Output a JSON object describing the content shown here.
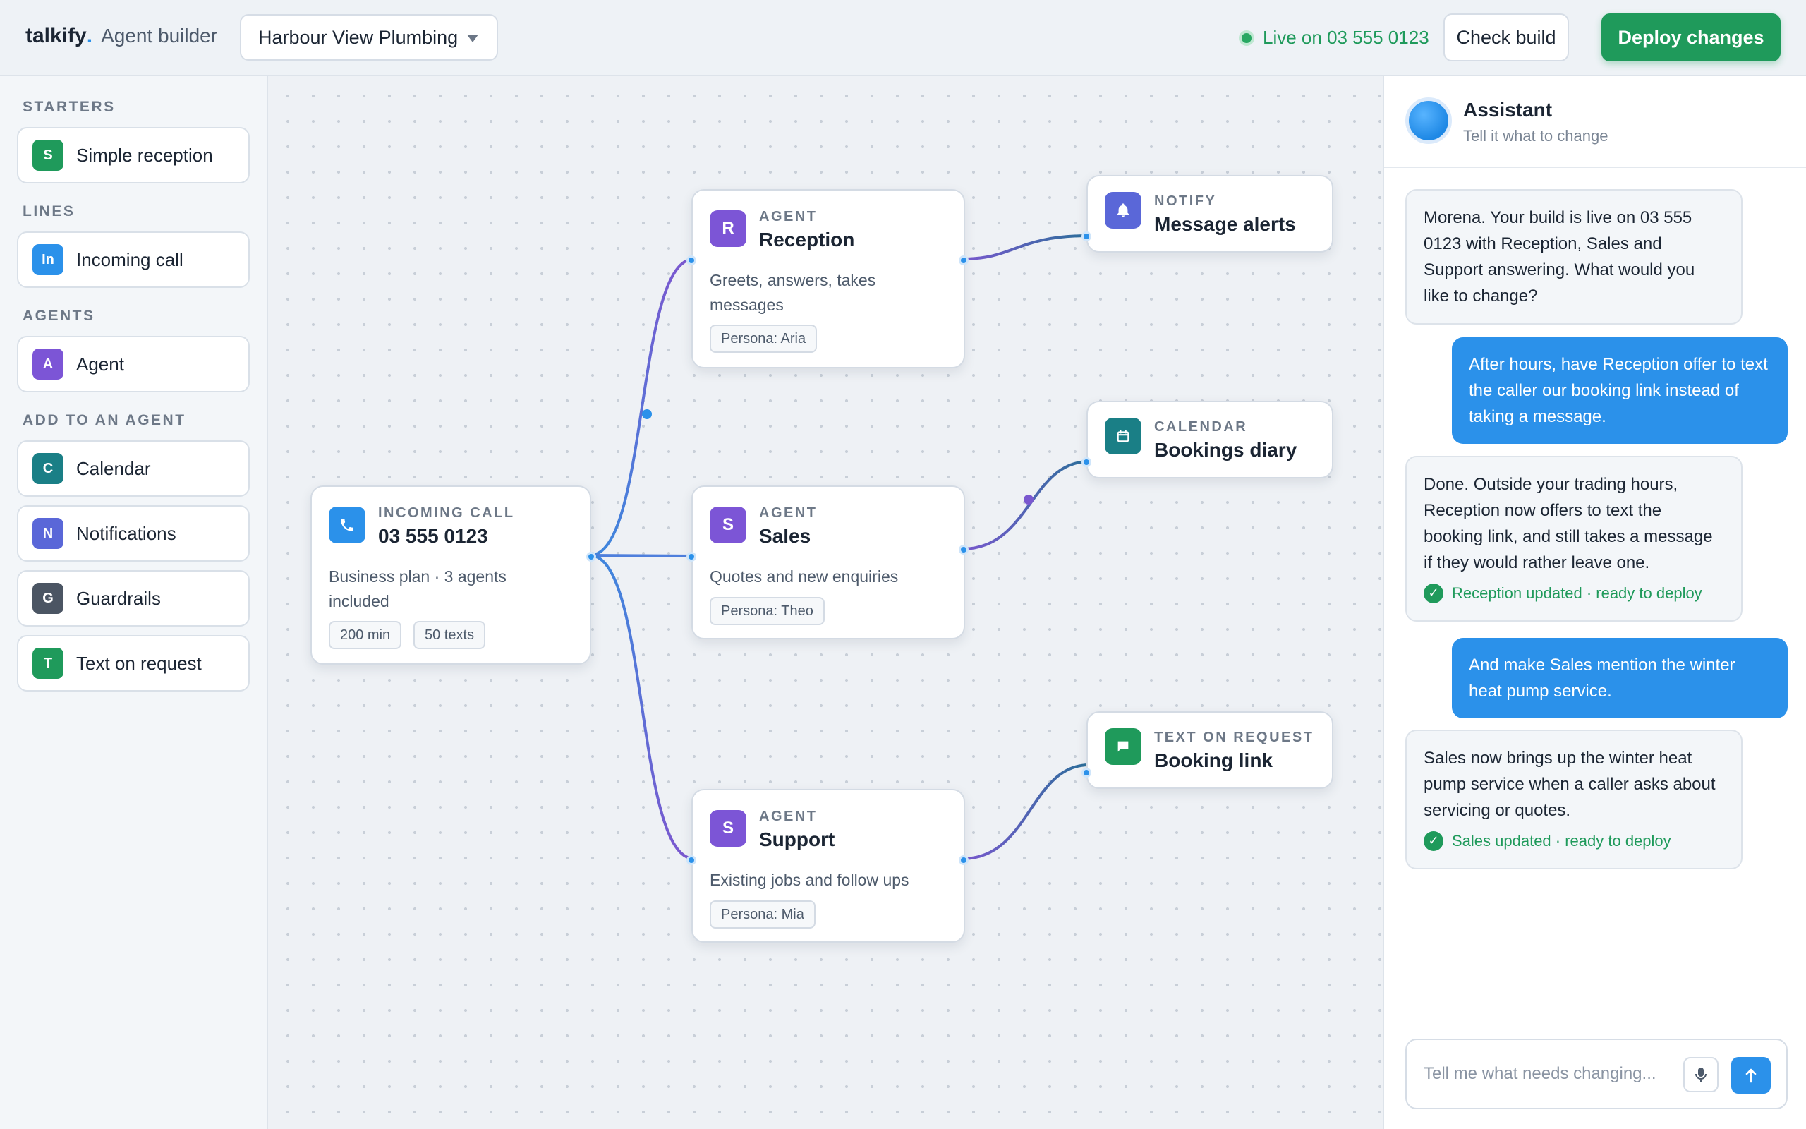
{
  "app": {
    "brand": "talkify",
    "brand_dot": ".",
    "subtitle": "Agent builder"
  },
  "workspace": {
    "name": "Harbour View Plumbing"
  },
  "header": {
    "live_status": "Live on 03 555 0123",
    "check_label": "Check build",
    "deploy_label": "Deploy changes"
  },
  "palette": {
    "starters": {
      "heading": "STARTERS",
      "items": [
        {
          "badge": "S",
          "label": "Simple reception",
          "color": "#1f9a5b"
        }
      ]
    },
    "lines": {
      "heading": "LINES",
      "items": [
        {
          "badge": "In",
          "label": "Incoming call",
          "color": "#2b91ea"
        }
      ]
    },
    "agents": {
      "heading": "AGENTS",
      "items": [
        {
          "badge": "A",
          "label": "Agent",
          "color": "#7c55d6"
        }
      ]
    },
    "add": {
      "heading": "ADD TO AN AGENT",
      "items": [
        {
          "badge": "C",
          "label": "Calendar",
          "color": "#1a7f86"
        },
        {
          "badge": "N",
          "label": "Notifications",
          "color": "#5a67d8"
        },
        {
          "badge": "G",
          "label": "Guardrails",
          "color": "#4b5563"
        },
        {
          "badge": "T",
          "label": "Text on request",
          "color": "#1f9a5b"
        }
      ]
    }
  },
  "nodes": {
    "incoming": {
      "kind": "INCOMING CALL",
      "title": "03 555 0123",
      "desc": "Business plan · 3 agents included",
      "chips": [
        "200 min",
        "50 texts"
      ],
      "color": "#2b91ea"
    },
    "reception": {
      "badge": "R",
      "kind": "AGENT",
      "title": "Reception",
      "desc": "Greets, answers, takes messages",
      "chip": "Persona: Aria",
      "color": "#7c55d6"
    },
    "sales": {
      "badge": "S",
      "kind": "AGENT",
      "title": "Sales",
      "desc": "Quotes and new enquiries",
      "chip": "Persona: Theo",
      "color": "#7c55d6"
    },
    "support": {
      "badge": "S",
      "kind": "AGENT",
      "title": "Support",
      "desc": "Existing jobs and follow ups",
      "chip": "Persona: Mia",
      "color": "#7c55d6"
    },
    "notify": {
      "kind": "NOTIFY",
      "title": "Message alerts",
      "color": "#5a67d8"
    },
    "calendar": {
      "kind": "CALENDAR",
      "title": "Bookings diary",
      "color": "#1a7f86"
    },
    "text": {
      "kind": "TEXT ON REQUEST",
      "title": "Booking link",
      "color": "#1f9a5b"
    }
  },
  "assistant": {
    "name": "Assistant",
    "subtitle": "Tell it what to change",
    "messages": [
      {
        "from": "bot",
        "text": "Morena. Your build is live on 03 555 0123 with Reception, Sales and Support answering. What would you like to change?"
      },
      {
        "from": "user",
        "text": "After hours, have Reception offer to text the caller our booking link instead of taking a message."
      },
      {
        "from": "bot",
        "text": "Done. Outside your trading hours, Reception now offers to text the booking link, and still takes a message if they would rather leave one.",
        "status": "Reception updated · ready to deploy"
      },
      {
        "from": "user",
        "text": "And make Sales mention the winter heat pump service."
      },
      {
        "from": "bot",
        "text": "Sales now brings up the winter heat pump service when a caller asks about servicing or quotes.",
        "status": "Sales updated · ready to deploy"
      }
    ],
    "composer_placeholder": "Tell me what needs changing..."
  },
  "colors": {
    "accent": "#2b91ea",
    "deploy": "#1f9a5b",
    "agent": "#7c55d6",
    "wire_blue": "#3f86dd",
    "wire_purple": "#7a58cf",
    "wire_teal": "#2a6f99"
  }
}
